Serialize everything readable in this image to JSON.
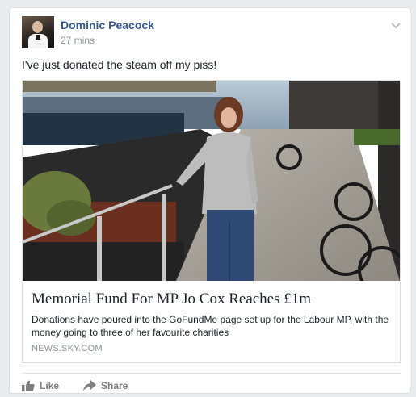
{
  "post": {
    "author": "Dominic Peacock",
    "timestamp": "27 mins",
    "text": "I've just donated the steam off my piss!",
    "link": {
      "title": "Memorial Fund For MP Jo Cox Reaches £1m",
      "description": "Donations have poured into the GoFundMe page set up for the Labour MP, with the money going to three of her favourite charities",
      "domain": "NEWS.SKY.COM"
    }
  },
  "actions": {
    "like_label": "Like",
    "share_label": "Share"
  },
  "icons": {
    "options": "chevron-down-icon",
    "like": "thumbs-up-icon",
    "share": "share-arrow-icon"
  },
  "colors": {
    "author_link": "#365899",
    "secondary_text": "#90949c",
    "action_text": "#7f7f7f",
    "background": "#e9ebee"
  }
}
